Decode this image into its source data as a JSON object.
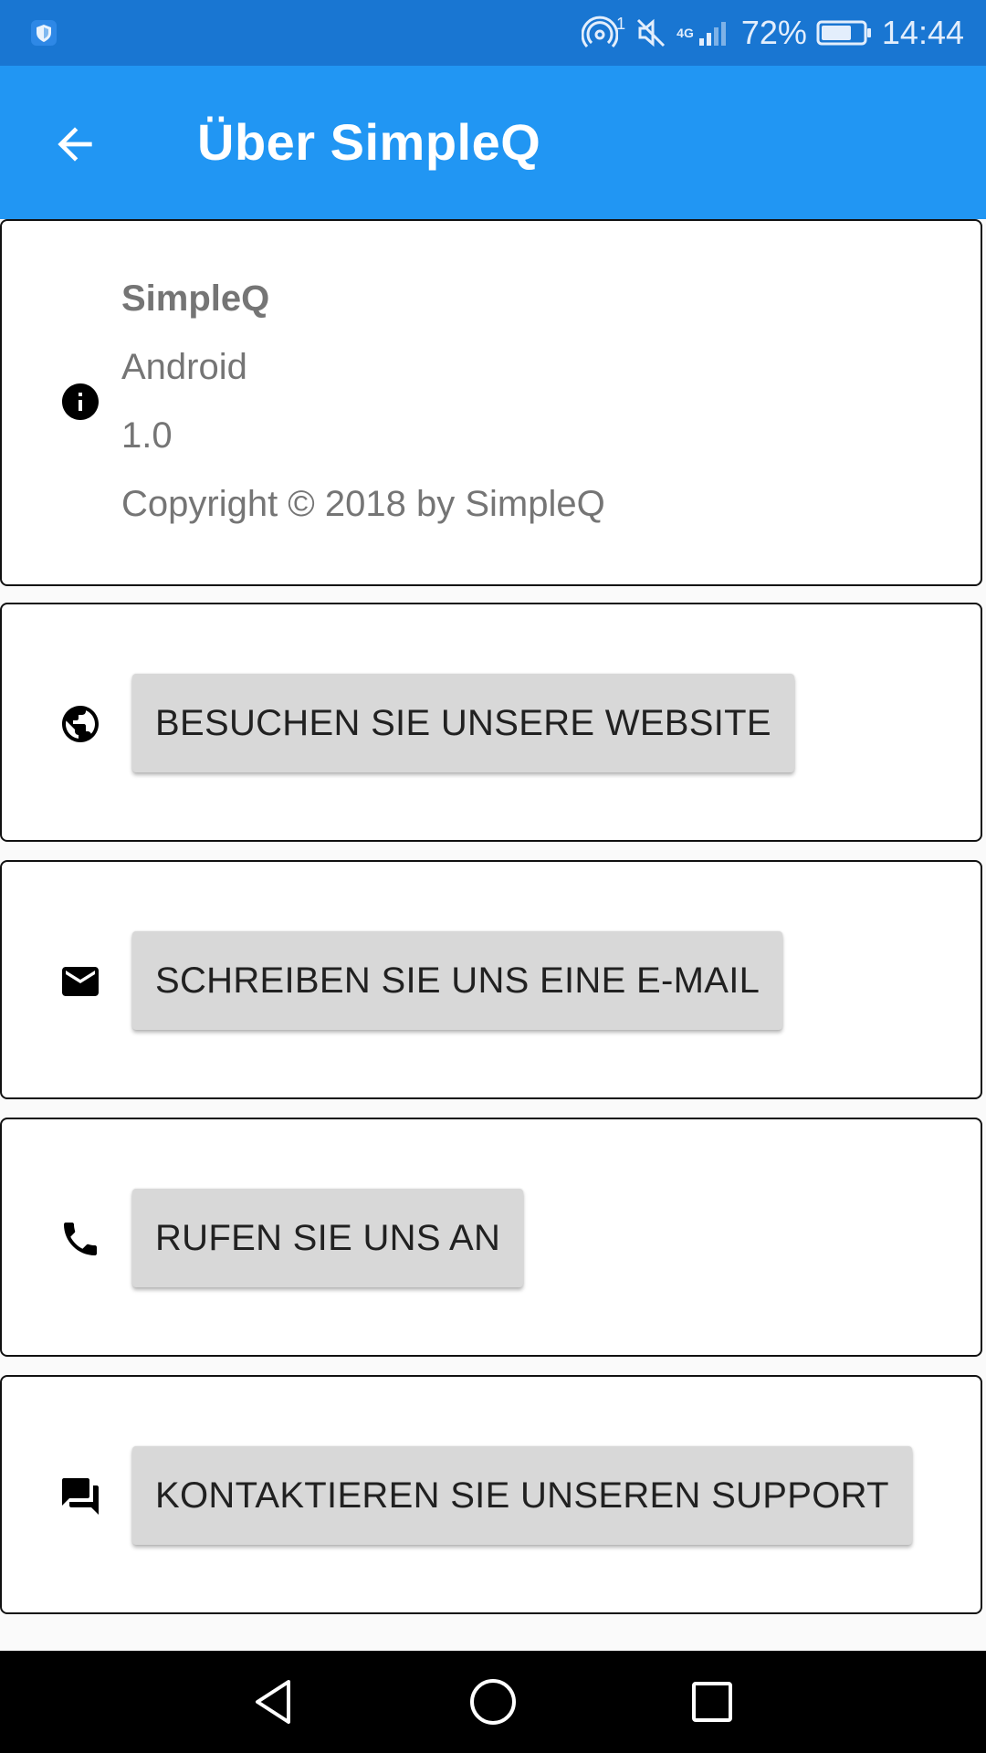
{
  "status_bar": {
    "network_label": "4G",
    "hotspot_count": "1",
    "battery_percent": "72%",
    "battery_level": 0.72,
    "time": "14:44",
    "icons": [
      "shield-icon",
      "hotspot-icon",
      "mute-icon",
      "signal-icon",
      "battery-icon"
    ]
  },
  "app_bar": {
    "title": "Über SimpleQ",
    "back_icon": "arrow-back-icon"
  },
  "info_card": {
    "icon": "info-icon",
    "app_name": "SimpleQ",
    "platform": "Android",
    "version": "1.0",
    "copyright": "Copyright © 2018 by SimpleQ"
  },
  "actions": [
    {
      "icon": "globe-icon",
      "label": "BESUCHEN SIE UNSERE WEBSITE"
    },
    {
      "icon": "email-icon",
      "label": "SCHREIBEN SIE UNS EINE E-MAIL"
    },
    {
      "icon": "phone-icon",
      "label": "RUFEN SIE UNS AN"
    },
    {
      "icon": "chat-icon",
      "label": "KONTAKTIEREN SIE UNSEREN SUPPORT"
    }
  ],
  "nav_bar": {
    "buttons": [
      "back-triangle-icon",
      "home-circle-icon",
      "recents-square-icon"
    ]
  },
  "colors": {
    "status_bar": "#1976d2",
    "app_bar": "#2196f3",
    "button_bg": "#d8d8d8",
    "secondary_text": "#757575"
  }
}
